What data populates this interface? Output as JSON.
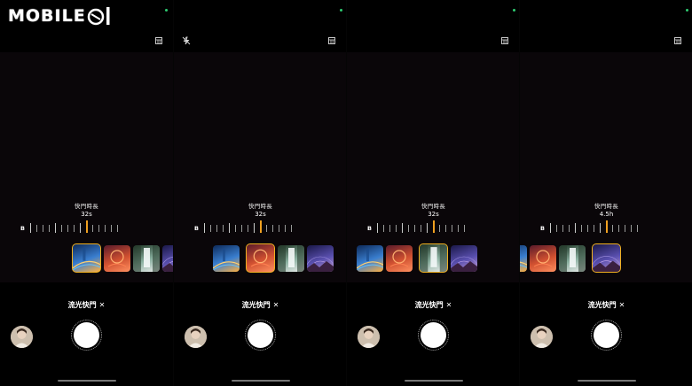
{
  "watermark": {
    "text": "MOBILE"
  },
  "panels": [
    {
      "duration_label": "快門時長",
      "duration_value": "32s",
      "scale_start": "B",
      "mode_label": "流光快門",
      "close_symbol": "✕",
      "selected_effect": 0,
      "top_left_icon": "",
      "top_right_icon": "settings-icon"
    },
    {
      "duration_label": "快門時長",
      "duration_value": "32s",
      "scale_start": "B",
      "mode_label": "流光快門",
      "close_symbol": "✕",
      "selected_effect": 1,
      "top_left_icon": "flash-off-icon",
      "top_right_icon": "settings-icon"
    },
    {
      "duration_label": "快門時長",
      "duration_value": "32s",
      "scale_start": "B",
      "mode_label": "流光快門",
      "close_symbol": "✕",
      "selected_effect": 2,
      "top_left_icon": "",
      "top_right_icon": "settings-icon"
    },
    {
      "duration_label": "快門時長",
      "duration_value": "4.5h",
      "scale_start": "B",
      "mode_label": "流光快門",
      "close_symbol": "✕",
      "selected_effect": 3,
      "top_left_icon": "",
      "top_right_icon": "settings-icon"
    }
  ],
  "effects": [
    {
      "name": "vehicle-trails",
      "colors": [
        "#0d2a5a",
        "#3a7fd0",
        "#ffb040"
      ]
    },
    {
      "name": "light-painting",
      "colors": [
        "#5a1a2a",
        "#d05030",
        "#ff9060"
      ]
    },
    {
      "name": "silky-water",
      "colors": [
        "#1a3020",
        "#8ab0a0",
        "#f0f0f0"
      ]
    },
    {
      "name": "star-trails",
      "colors": [
        "#1a1848",
        "#5a50b0",
        "#c8a0d0"
      ]
    }
  ],
  "accent_color": "#f0a020"
}
